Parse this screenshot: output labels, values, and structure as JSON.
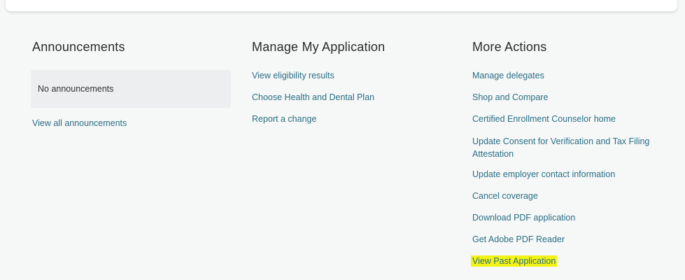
{
  "announcements": {
    "heading": "Announcements",
    "empty_text": "No announcements",
    "view_all_link": "View all announcements"
  },
  "manage": {
    "heading": "Manage My Application",
    "links": [
      "View eligibility results",
      "Choose Health and Dental Plan",
      "Report a change"
    ]
  },
  "more": {
    "heading": "More Actions",
    "links": [
      "Manage delegates",
      "Shop and Compare",
      "Certified Enrollment Counselor home",
      "Update Consent for Verification and Tax Filing Attestation",
      "Update employer contact information",
      "Cancel coverage",
      "Download PDF application",
      "Get Adobe PDF Reader",
      "View Past Application"
    ]
  },
  "colors": {
    "link": "#2a6f85",
    "highlight": "#f3f315",
    "background": "#f6f7f7"
  }
}
